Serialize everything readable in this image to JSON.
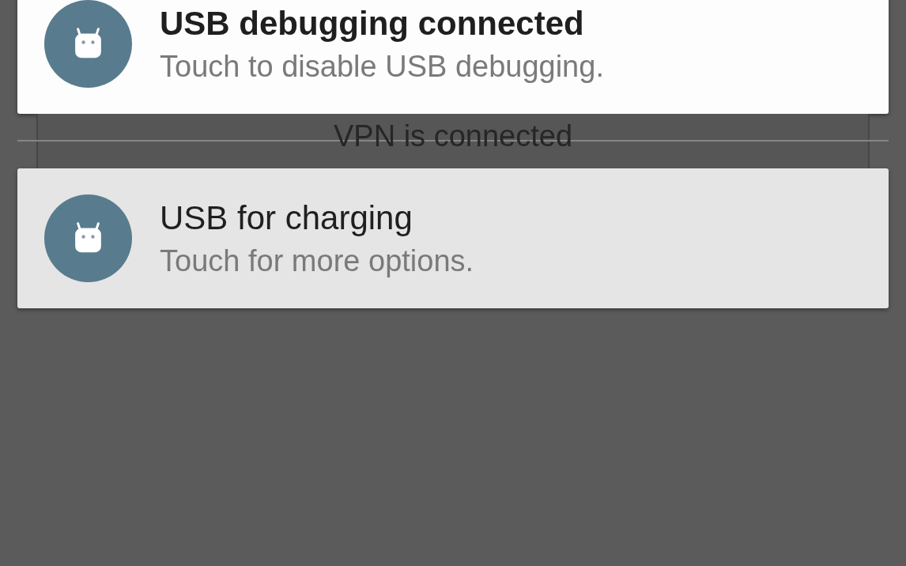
{
  "notifications": [
    {
      "kind": "card",
      "title": "USB debugging connected",
      "text": "Touch to disable USB debugging.",
      "pressed": false
    },
    {
      "kind": "collapsed",
      "title": "VPN is connected",
      "pressed": false
    },
    {
      "kind": "card",
      "title": "USB for charging",
      "text": "Touch for more options.",
      "pressed": true
    }
  ]
}
